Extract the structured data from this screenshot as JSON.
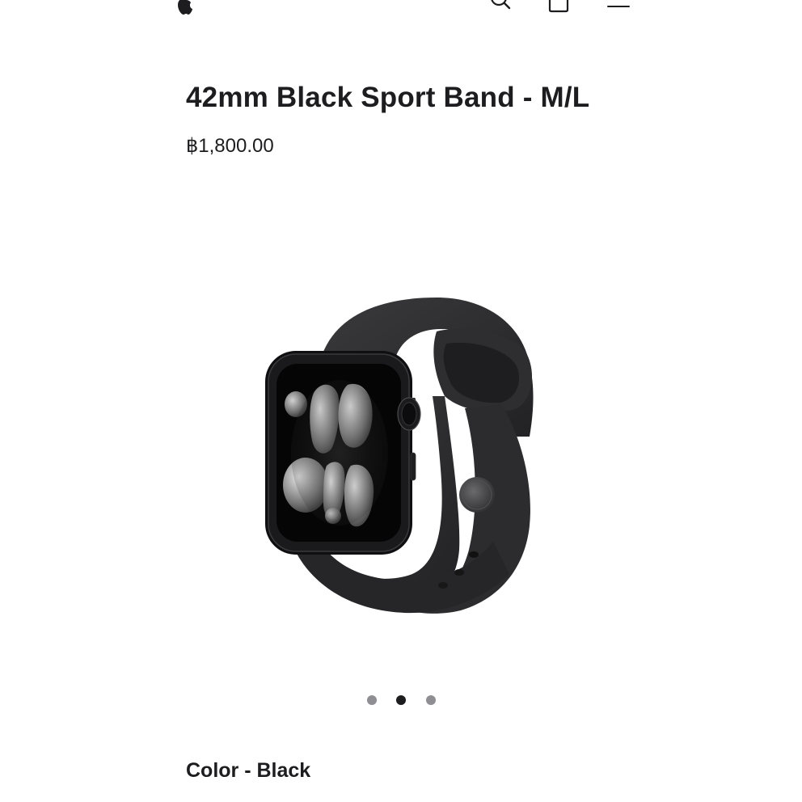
{
  "nav": {
    "icons": [
      "apple-logo",
      "search-icon",
      "bag-icon",
      "menu-icon"
    ]
  },
  "product": {
    "title": "42mm Black Sport Band - M/L",
    "price": "฿1,800.00",
    "color_label": "Color - Black"
  },
  "gallery": {
    "dot_count": 3,
    "active_index": 1
  },
  "colors": {
    "text": "#1d1d1f",
    "dot_inactive": "#8e8e93",
    "dot_active": "#1d1d1f",
    "band": "#2b2b2d",
    "case": "#121214"
  }
}
